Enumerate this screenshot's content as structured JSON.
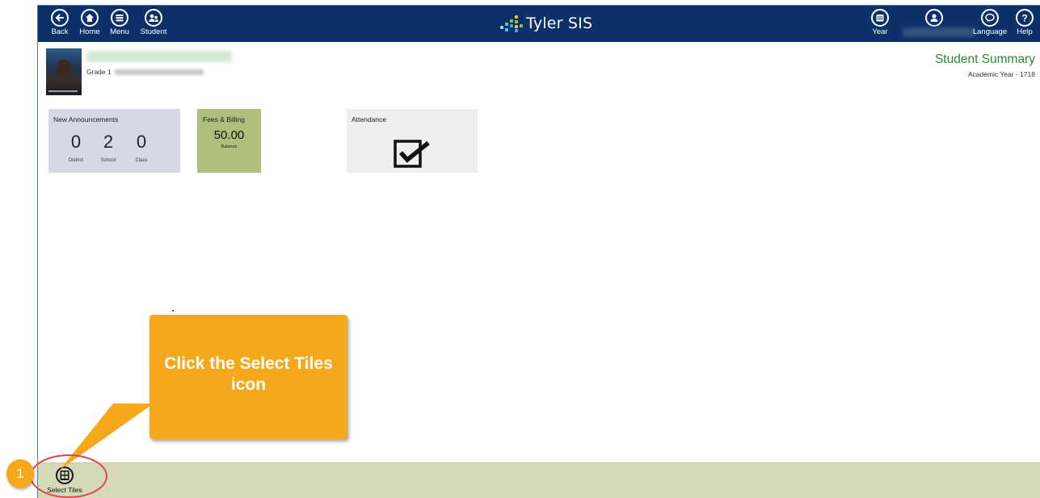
{
  "nav": {
    "back_label": "Back",
    "home_label": "Home",
    "menu_label": "Menu",
    "student_label": "Student",
    "year_label": "Year",
    "language_label": "Language",
    "help_label": "Help"
  },
  "brand": {
    "name": "Tyler SIS"
  },
  "header": {
    "grade_prefix": "Grade 1",
    "page_title": "Student Summary",
    "academic_year": "Academic Year - 1718"
  },
  "tiles": {
    "announcements": {
      "title": "New Announcements",
      "district_count": "0",
      "school_count": "2",
      "class_count": "0",
      "district_label": "District",
      "school_label": "School",
      "class_label": "Class"
    },
    "fees": {
      "title": "Fees & Billing",
      "value": "50.00",
      "caption": "Balance"
    },
    "attendance": {
      "title": "Attendance",
      "icon": "checkbox-icon"
    }
  },
  "bottombar": {
    "select_tiles_label": "Select Tiles"
  },
  "callout": {
    "text": "Click the Select Tiles icon",
    "step_number": "1",
    "color": "#f6a81c"
  },
  "colors": {
    "topbar": "#0c3168",
    "title_green": "#2e8b2e",
    "announcements_tile": "#d4d9e3",
    "fees_tile": "#afbe7a",
    "attendance_tile": "#efefef",
    "bottombar": "#d5d9b8"
  }
}
